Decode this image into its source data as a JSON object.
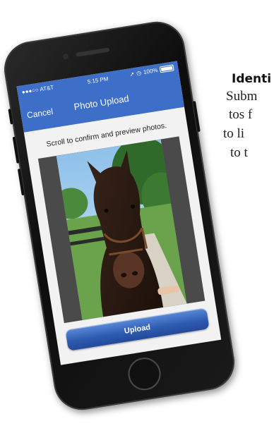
{
  "article": {
    "heading": "Identi",
    "lines": [
      "Subm",
      "tos f",
      "to li",
      "to t"
    ]
  },
  "status_bar": {
    "carrier": "●●●○○ AT&T",
    "time": "5:15 PM",
    "battery": "100%"
  },
  "nav": {
    "cancel_label": "Cancel",
    "title": "Photo Upload"
  },
  "content": {
    "instruction": "Scroll to confirm and preview photos.",
    "upload_label": "Upload"
  },
  "colors": {
    "nav_blue": "#3d6ec8",
    "button_blue": "#2e5cb0"
  }
}
